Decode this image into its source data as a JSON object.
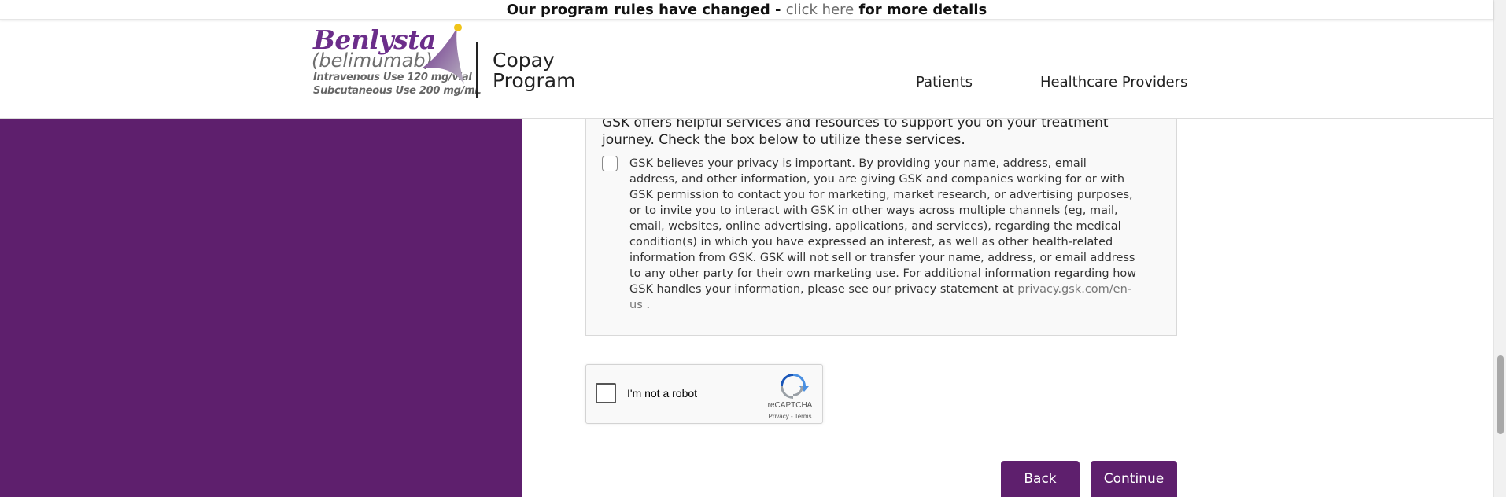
{
  "announcement": {
    "prefix": "Our program rules have changed - ",
    "link": "click here",
    "suffix": " for more details"
  },
  "header": {
    "brand_name": "Benlysta",
    "brand_generic": "(belimumab)",
    "brand_line1": "Intravenous Use 120 mg/vial",
    "brand_line2": "Subcutaneous Use 200 mg/mL",
    "program_line1": "Copay",
    "program_line2": "Program",
    "nav": [
      "Patients",
      "Healthcare Providers"
    ]
  },
  "services": {
    "intro": "GSK offers helpful services and resources to support you on your treatment journey. Check the box below to utilize these services.",
    "privacy_text": "GSK believes your privacy is important. By providing your name, address, email address, and other information, you are giving GSK and companies working for or with GSK permission to contact you for marketing, market research, or advertising purposes, or to invite you to interact with GSK in other ways across multiple channels (eg, mail, email, websites, online advertising, applications, and services), regarding the medical condition(s) in which you have expressed an interest, as well as other health-related information from GSK. GSK will not sell or transfer your name, address, or email address to any other party for their own marketing use. For additional information regarding how GSK handles your information, please see our privacy statement at ",
    "privacy_link": "privacy.gsk.com/en-us",
    "privacy_end": " ."
  },
  "recaptcha": {
    "label": "I'm not a robot",
    "brand": "reCAPTCHA",
    "links": "Privacy - Terms"
  },
  "buttons": {
    "back": "Back",
    "continue": "Continue"
  },
  "colors": {
    "brand_purple": "#5e1f6d",
    "logo_purple": "#6b2d8a"
  }
}
